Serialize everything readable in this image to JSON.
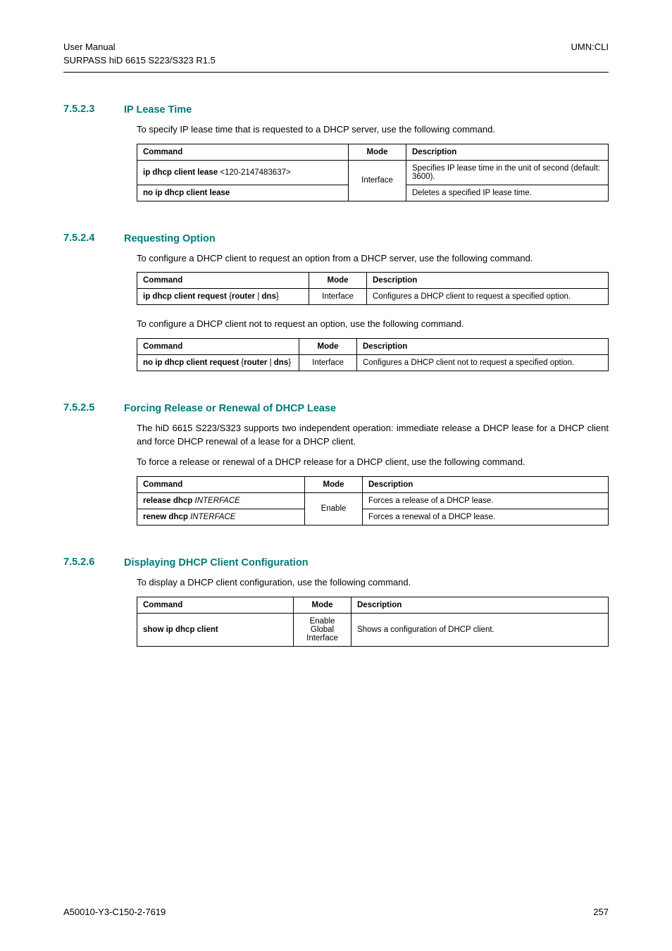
{
  "header": {
    "left_line1": "User Manual",
    "left_line2": "SURPASS hiD 6615 S223/S323 R1.5",
    "right": "UMN:CLI"
  },
  "sections": [
    {
      "num": "7.5.2.3",
      "title": "IP Lease Time",
      "paras": [
        "To specify IP lease time that is requested to a DHCP server, use the following command."
      ],
      "table": {
        "head": [
          "Command",
          "Mode",
          "Description"
        ],
        "cmdcol_w": "w-cmd-a",
        "rows": [
          {
            "cmd": [
              {
                "t": "ip dhcp client lease ",
                "b": true
              },
              {
                "t": "<120-2147483637>",
                "b": false
              }
            ],
            "mode": "Interface",
            "mode_rowspan": 2,
            "desc": "Specifies IP lease time in the unit of second (default: 3600)."
          },
          {
            "cmd": [
              {
                "t": "no ip dhcp client lease",
                "b": true
              }
            ],
            "desc": "Deletes a specified IP lease time."
          }
        ]
      }
    },
    {
      "num": "7.5.2.4",
      "title": "Requesting Option",
      "paras": [
        "To configure a DHCP client to request an option from a DHCP server, use the following command."
      ],
      "table": {
        "head": [
          "Command",
          "Mode",
          "Description"
        ],
        "cmdcol_w": "w-cmd-b",
        "rows": [
          {
            "cmd": [
              {
                "t": "ip dhcp client request ",
                "b": true
              },
              {
                "t": "{",
                "b": false
              },
              {
                "t": "router",
                "b": true
              },
              {
                "t": " | ",
                "b": false
              },
              {
                "t": "dns",
                "b": true
              },
              {
                "t": "}",
                "b": false
              }
            ],
            "mode": "Interface",
            "desc": "Configures a DHCP client to request a specified option."
          }
        ]
      },
      "paras2": [
        "To configure a DHCP client not to request an option, use the following command."
      ],
      "table2": {
        "head": [
          "Command",
          "Mode",
          "Description"
        ],
        "cmdcol_w": "w-cmd-c",
        "rows": [
          {
            "cmd": [
              {
                "t": "no ip dhcp client request ",
                "b": true
              },
              {
                "t": "{",
                "b": false
              },
              {
                "t": "router",
                "b": true
              },
              {
                "t": " | ",
                "b": false
              },
              {
                "t": "dns",
                "b": true
              },
              {
                "t": "}",
                "b": false
              }
            ],
            "mode": "Interface",
            "desc": "Configures a DHCP client not to request a specified option."
          }
        ]
      }
    },
    {
      "num": "7.5.2.5",
      "title": "Forcing Release or Renewal of DHCP Lease",
      "paras": [
        "The hiD 6615 S223/S323 supports two independent operation: immediate release a DHCP lease for a DHCP client and force DHCP renewal of a lease for a DHCP client.",
        "To force a release or renewal of a DHCP release for a DHCP client, use the following command."
      ],
      "table": {
        "head": [
          "Command",
          "Mode",
          "Description"
        ],
        "cmdcol_w": "w-cmd-d",
        "rows": [
          {
            "cmd": [
              {
                "t": "release dhcp ",
                "b": true
              },
              {
                "t": "INTERFACE",
                "b": false,
                "i": true
              }
            ],
            "mode": "Enable",
            "mode_rowspan": 2,
            "desc": "Forces a release of a DHCP lease."
          },
          {
            "cmd": [
              {
                "t": "renew dhcp ",
                "b": true
              },
              {
                "t": "INTERFACE",
                "b": false,
                "i": true
              }
            ],
            "desc": "Forces a renewal of a DHCP lease."
          }
        ]
      }
    },
    {
      "num": "7.5.2.6",
      "title": "Displaying DHCP Client Configuration",
      "paras": [
        "To display a DHCP client configuration, use the following command."
      ],
      "table": {
        "head": [
          "Command",
          "Mode",
          "Description"
        ],
        "cmdcol_w": "w-cmd-e",
        "rows": [
          {
            "cmd": [
              {
                "t": "show ip dhcp client",
                "b": true
              }
            ],
            "mode_multi": [
              "Enable",
              "Global",
              "Interface"
            ],
            "desc": "Shows a configuration of DHCP client."
          }
        ]
      }
    }
  ],
  "footer": {
    "left": "A50010-Y3-C150-2-7619",
    "right": "257"
  }
}
